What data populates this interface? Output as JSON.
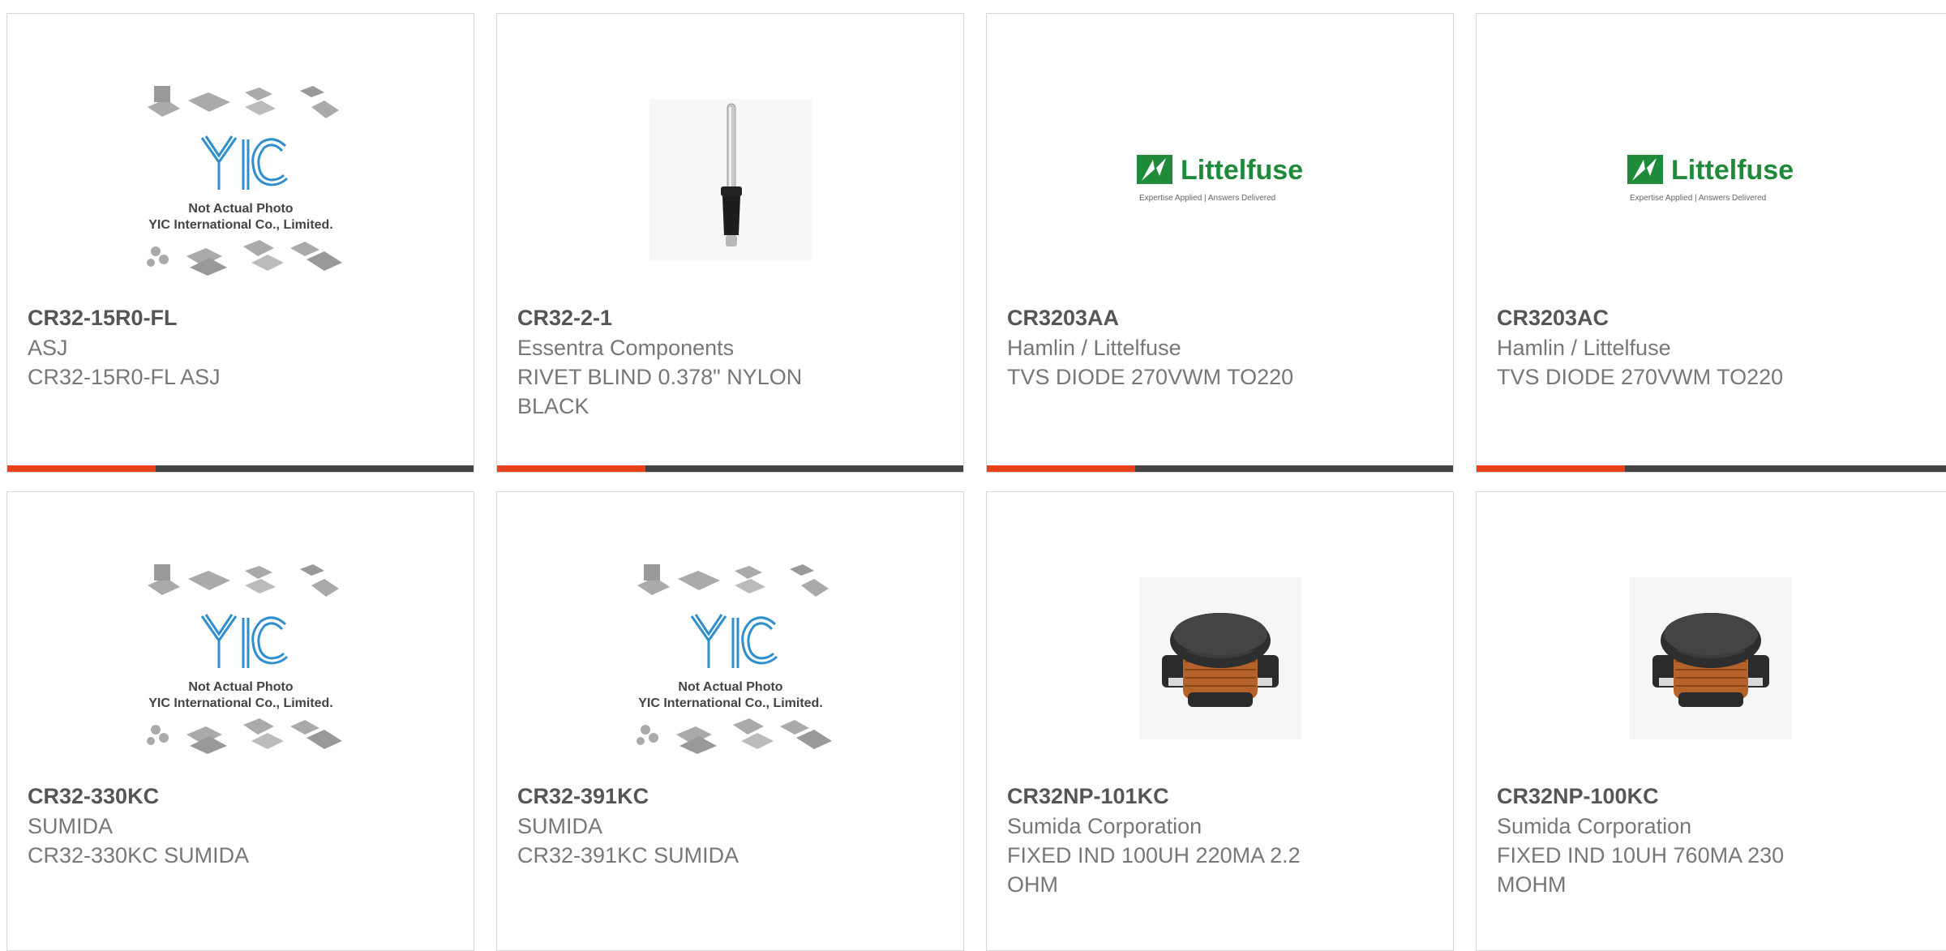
{
  "placeholder": {
    "line1": "Not Actual Photo",
    "line2": "YIC International Co., Limited.",
    "logo": "YIC"
  },
  "littelfuse": {
    "brand": "Littelfuse",
    "tagline": "Expertise Applied | Answers Delivered"
  },
  "colors": {
    "accent": "#e8411c",
    "bar": "#444444",
    "border": "#d6d6d6",
    "text": "#777777"
  },
  "products": [
    {
      "part": "CR32-15R0-FL",
      "manufacturer": "ASJ",
      "description": "CR32-15R0-FL ASJ",
      "image": "yic-placeholder"
    },
    {
      "part": "CR32-2-1",
      "manufacturer": "Essentra Components",
      "description": "RIVET BLIND 0.378\" NYLON BLACK",
      "image": "rivet-photo"
    },
    {
      "part": "CR3203AA",
      "manufacturer": "Hamlin / Littelfuse",
      "description": "TVS DIODE 270VWM TO220",
      "image": "littelfuse-logo"
    },
    {
      "part": "CR3203AC",
      "manufacturer": "Hamlin / Littelfuse",
      "description": "TVS DIODE 270VWM TO220",
      "image": "littelfuse-logo"
    },
    {
      "part": "CR32-330KC",
      "manufacturer": "SUMIDA",
      "description": "CR32-330KC SUMIDA",
      "image": "yic-placeholder"
    },
    {
      "part": "CR32-391KC",
      "manufacturer": "SUMIDA",
      "description": "CR32-391KC SUMIDA",
      "image": "yic-placeholder"
    },
    {
      "part": "CR32NP-101KC",
      "manufacturer": "Sumida Corporation",
      "description": "FIXED IND 100UH 220MA 2.2 OHM",
      "image": "inductor-photo"
    },
    {
      "part": "CR32NP-100KC",
      "manufacturer": "Sumida Corporation",
      "description": "FIXED IND 10UH 760MA 230 MOHM",
      "image": "inductor-photo"
    }
  ]
}
